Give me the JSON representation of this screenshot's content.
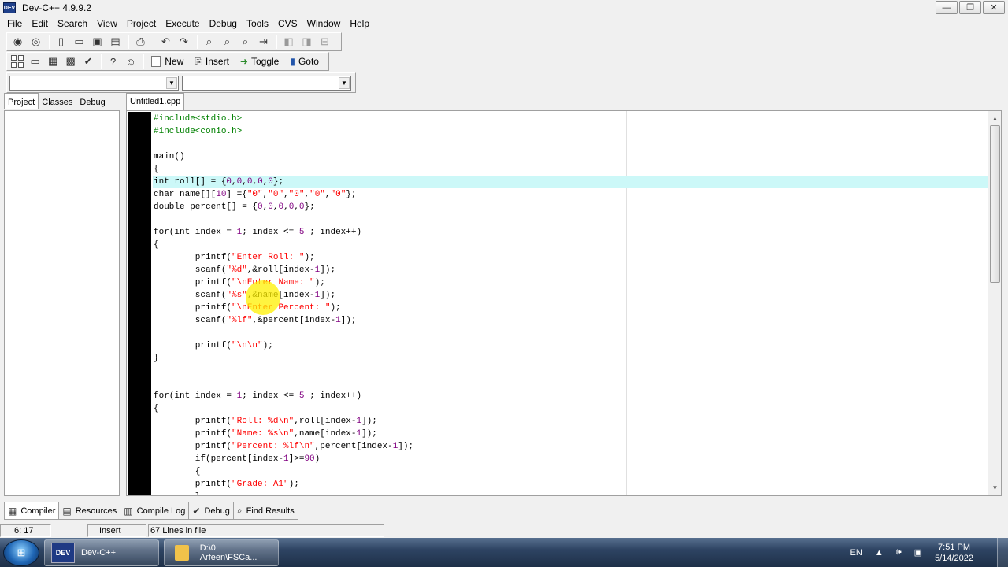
{
  "window": {
    "title": "Dev-C++ 4.9.9.2",
    "app_icon_text": "DEV"
  },
  "window_controls": {
    "minimize": "—",
    "maximize": "❐",
    "close": "✕"
  },
  "menu": [
    "File",
    "Edit",
    "Search",
    "View",
    "Project",
    "Execute",
    "Debug",
    "Tools",
    "CVS",
    "Window",
    "Help"
  ],
  "toolbar2": {
    "new_label": "New",
    "insert_label": "Insert",
    "toggle_label": "Toggle",
    "goto_label": "Goto"
  },
  "left_tabs": [
    "Project",
    "Classes",
    "Debug"
  ],
  "editor": {
    "file_tab": "Untitled1.cpp"
  },
  "code_lines": [
    [
      [
        "pre",
        "#include<stdio.h>"
      ]
    ],
    [
      [
        "pre",
        "#include<conio.h>"
      ]
    ],
    [
      [
        "txt",
        ""
      ]
    ],
    [
      [
        "txt",
        "main()"
      ]
    ],
    [
      [
        "txt",
        "{"
      ]
    ],
    [
      [
        "txt",
        "int roll[] = {"
      ],
      [
        "num",
        "0"
      ],
      [
        "txt",
        ","
      ],
      [
        "num",
        "0"
      ],
      [
        "txt",
        ","
      ],
      [
        "num",
        "0"
      ],
      [
        "txt",
        ","
      ],
      [
        "num",
        "0"
      ],
      [
        "txt",
        ","
      ],
      [
        "num",
        "0"
      ],
      [
        "txt",
        "};"
      ]
    ],
    [
      [
        "txt",
        "char name[]["
      ],
      [
        "num",
        "10"
      ],
      [
        "txt",
        "] ={"
      ],
      [
        "str",
        "\"0\""
      ],
      [
        "txt",
        ","
      ],
      [
        "str",
        "\"0\""
      ],
      [
        "txt",
        ","
      ],
      [
        "str",
        "\"0\""
      ],
      [
        "txt",
        ","
      ],
      [
        "str",
        "\"0\""
      ],
      [
        "txt",
        ","
      ],
      [
        "str",
        "\"0\""
      ],
      [
        "txt",
        "};"
      ]
    ],
    [
      [
        "txt",
        "double percent[] = {"
      ],
      [
        "num",
        "0"
      ],
      [
        "txt",
        ","
      ],
      [
        "num",
        "0"
      ],
      [
        "txt",
        ","
      ],
      [
        "num",
        "0"
      ],
      [
        "txt",
        ","
      ],
      [
        "num",
        "0"
      ],
      [
        "txt",
        ","
      ],
      [
        "num",
        "0"
      ],
      [
        "txt",
        "};"
      ]
    ],
    [
      [
        "txt",
        ""
      ]
    ],
    [
      [
        "txt",
        "for(int index = "
      ],
      [
        "num",
        "1"
      ],
      [
        "txt",
        "; index <= "
      ],
      [
        "num",
        "5"
      ],
      [
        "txt",
        " ; index++)"
      ]
    ],
    [
      [
        "txt",
        "{"
      ]
    ],
    [
      [
        "txt",
        "        printf("
      ],
      [
        "str",
        "\"Enter Roll: \""
      ],
      [
        "txt",
        ");"
      ]
    ],
    [
      [
        "txt",
        "        scanf("
      ],
      [
        "str",
        "\"%d\""
      ],
      [
        "txt",
        ",&roll[index-"
      ],
      [
        "num",
        "1"
      ],
      [
        "txt",
        "]);"
      ]
    ],
    [
      [
        "txt",
        "        printf("
      ],
      [
        "str",
        "\"\\nEnter Name: \""
      ],
      [
        "txt",
        ");"
      ]
    ],
    [
      [
        "txt",
        "        scanf("
      ],
      [
        "str",
        "\"%s\""
      ],
      [
        "txt",
        ",&name[index-"
      ],
      [
        "num",
        "1"
      ],
      [
        "txt",
        "]);"
      ]
    ],
    [
      [
        "txt",
        "        printf("
      ],
      [
        "str",
        "\"\\nEnter Percent: \""
      ],
      [
        "txt",
        ");"
      ]
    ],
    [
      [
        "txt",
        "        scanf("
      ],
      [
        "str",
        "\"%lf\""
      ],
      [
        "txt",
        ",&percent[index-"
      ],
      [
        "num",
        "1"
      ],
      [
        "txt",
        "]);"
      ]
    ],
    [
      [
        "txt",
        ""
      ]
    ],
    [
      [
        "txt",
        "        printf("
      ],
      [
        "str",
        "\"\\n\\n\""
      ],
      [
        "txt",
        ");"
      ]
    ],
    [
      [
        "txt",
        "}"
      ]
    ],
    [
      [
        "txt",
        ""
      ]
    ],
    [
      [
        "txt",
        ""
      ]
    ],
    [
      [
        "txt",
        "for(int index = "
      ],
      [
        "num",
        "1"
      ],
      [
        "txt",
        "; index <= "
      ],
      [
        "num",
        "5"
      ],
      [
        "txt",
        " ; index++)"
      ]
    ],
    [
      [
        "txt",
        "{"
      ]
    ],
    [
      [
        "txt",
        "        printf("
      ],
      [
        "str",
        "\"Roll: %d\\n\""
      ],
      [
        "txt",
        ",roll[index-"
      ],
      [
        "num",
        "1"
      ],
      [
        "txt",
        "]);"
      ]
    ],
    [
      [
        "txt",
        "        printf("
      ],
      [
        "str",
        "\"Name: %s\\n\""
      ],
      [
        "txt",
        ",name[index-"
      ],
      [
        "num",
        "1"
      ],
      [
        "txt",
        "]);"
      ]
    ],
    [
      [
        "txt",
        "        printf("
      ],
      [
        "str",
        "\"Percent: %lf\\n\""
      ],
      [
        "txt",
        ",percent[index-"
      ],
      [
        "num",
        "1"
      ],
      [
        "txt",
        "]);"
      ]
    ],
    [
      [
        "txt",
        "        if(percent[index-"
      ],
      [
        "num",
        "1"
      ],
      [
        "txt",
        "]>="
      ],
      [
        "num",
        "90"
      ],
      [
        "txt",
        ")"
      ]
    ],
    [
      [
        "txt",
        "        {"
      ]
    ],
    [
      [
        "txt",
        "        printf("
      ],
      [
        "str",
        "\"Grade: A1\""
      ],
      [
        "txt",
        ");"
      ]
    ],
    [
      [
        "txt",
        "        }"
      ]
    ]
  ],
  "active_line_index": 5,
  "bottom_tabs": [
    {
      "label": "Compiler",
      "icon": "grid-icon"
    },
    {
      "label": "Resources",
      "icon": "resources-icon"
    },
    {
      "label": "Compile Log",
      "icon": "chart-icon"
    },
    {
      "label": "Debug",
      "icon": "check-icon"
    },
    {
      "label": "Find Results",
      "icon": "find-icon"
    }
  ],
  "status": {
    "position": "6: 17",
    "mode": "Insert",
    "lines": "67 Lines in file"
  },
  "taskbar": {
    "items": [
      {
        "label": "Dev-C++",
        "icon_text": "DEV"
      },
      {
        "label": "D:\\0 Arfeen\\FSCa..."
      }
    ],
    "lang": "EN",
    "time": "7:51 PM",
    "date": "5/14/2022"
  },
  "colors": {
    "preprocessor": "#008000",
    "string": "#ff0000",
    "number": "#800080",
    "active_line": "#ccf8f8",
    "gutter": "#000000"
  }
}
